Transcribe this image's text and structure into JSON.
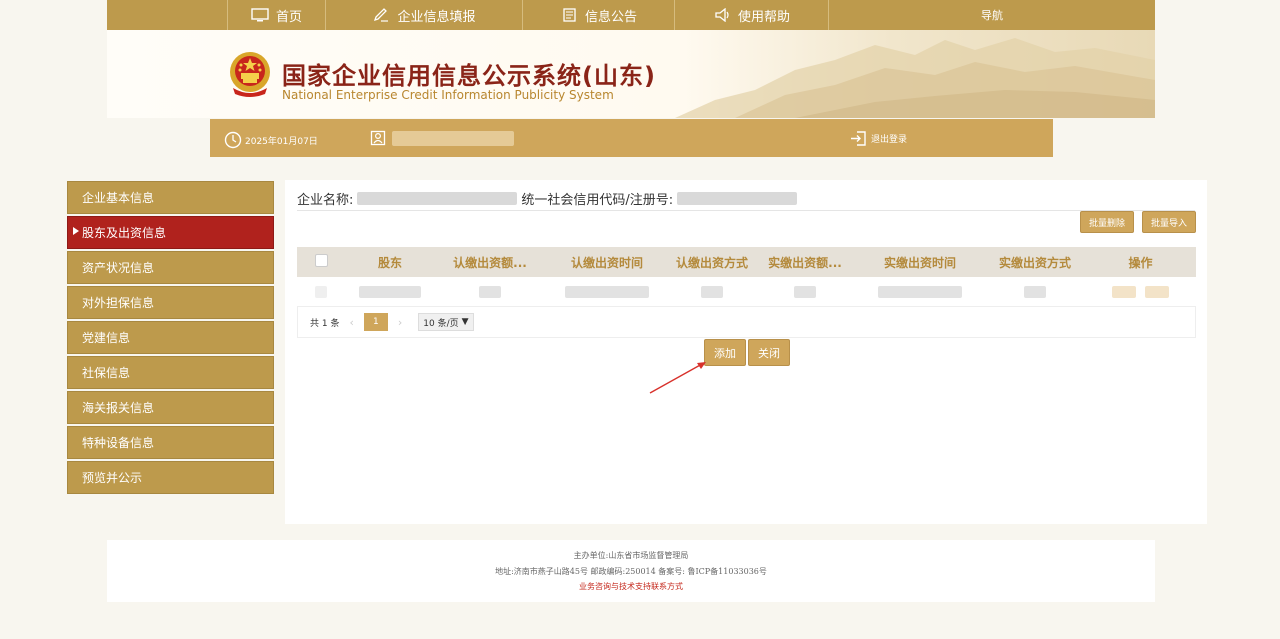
{
  "topnav": {
    "items": [
      {
        "label": "首页",
        "icon": "monitor-icon"
      },
      {
        "label": "企业信息填报",
        "icon": "edit-icon"
      },
      {
        "label": "信息公告",
        "icon": "notice-icon"
      },
      {
        "label": "使用帮助",
        "icon": "help-icon"
      }
    ],
    "nav_label": "导航"
  },
  "banner": {
    "title_cn": "国家企业信用信息公示系统(山东)",
    "title_en": "National Enterprise Credit Information Publicity System"
  },
  "infobar": {
    "date": "2025年01月07日",
    "logout": "退出登录"
  },
  "sidebar": {
    "items": [
      {
        "label": "企业基本信息"
      },
      {
        "label": "股东及出资信息",
        "active": true
      },
      {
        "label": "资产状况信息"
      },
      {
        "label": "对外担保信息"
      },
      {
        "label": "党建信息"
      },
      {
        "label": "社保信息"
      },
      {
        "label": "海关报关信息"
      },
      {
        "label": "特种设备信息"
      },
      {
        "label": "预览并公示"
      }
    ]
  },
  "main": {
    "company_label": "企业名称:",
    "credit_code_label": "统一社会信用代码/注册号:",
    "batch_delete": "批量删除",
    "batch_import": "批量导入",
    "columns": [
      "股东",
      "认缴出资额...",
      "认缴出资时间",
      "认缴出资方式",
      "实缴出资额...",
      "实缴出资时间",
      "实缴出资方式",
      "操作"
    ],
    "pager": {
      "total": "共 1 条",
      "current_page": "1",
      "page_size": "10 条/页"
    },
    "add_button": "添加",
    "close_button": "关闭"
  },
  "footer": {
    "line1": "主办单位:山东省市场监督管理局",
    "line2": "地址:济南市燕子山路45号    邮政编码:250014    备案号: 鲁ICP备11033036号",
    "line3": "业务咨询与技术支持联系方式"
  },
  "colors": {
    "gold": "#bd9a4c",
    "active_red": "#b0221d",
    "header_text": "#b48a3c"
  }
}
